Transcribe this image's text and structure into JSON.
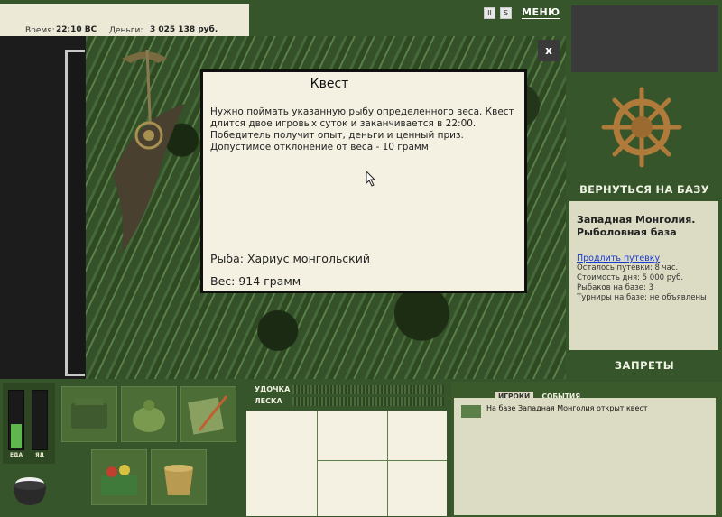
{
  "stats": {
    "time_label": "Время:",
    "time_value": "22:10 ВС",
    "money_label": "Деньги:",
    "money_value": "3 025 138 руб."
  },
  "controls": {
    "menu_label": "МЕНЮ",
    "pause_glyph": "II",
    "sound_glyph": "S"
  },
  "dialog": {
    "close_glyph": "x",
    "title": "Квест",
    "description": "Нужно поймать указанную рыбу определенного веса. Квест длится двое игровых суток и заканчивается в 22:00. Победитель получит опыт, деньги и ценный приз. Допустимое отклонение от веса - 10 грамм",
    "fish": "Рыба: Хариус монгольский",
    "weight": "Вес: 914 грамм"
  },
  "sidebar": {
    "return_label": "ВЕРНУТЬСЯ НА БАЗУ",
    "base_title": "Западная Монголия. Рыболовная база",
    "buy_link": "Продлить путевку",
    "info": [
      "Осталось путевки: 8 час.",
      "Стоимость дня: 5 000 руб.",
      "Рыбаков на базе: 3",
      "Турниры на базе: не объявлены"
    ],
    "bans_label": "ЗАПРЕТЫ"
  },
  "meters": {
    "food_label": "ЕДА",
    "poison_label": "ЯД",
    "food_level": 0.42,
    "poison_level": 0.0
  },
  "rod": {
    "rod_label": "УДОЧКА",
    "line_label": "ЛЕСКА"
  },
  "events": {
    "tab_players": "ИГРОКИ",
    "tab_events": "СОБЫТИЯ",
    "items": [
      "На базе Западная Монголия открыт квест"
    ]
  },
  "icons": {
    "fish": "fish-rod-icon",
    "wheel": "ship-wheel-icon",
    "pot": "cooking-pot-icon"
  }
}
